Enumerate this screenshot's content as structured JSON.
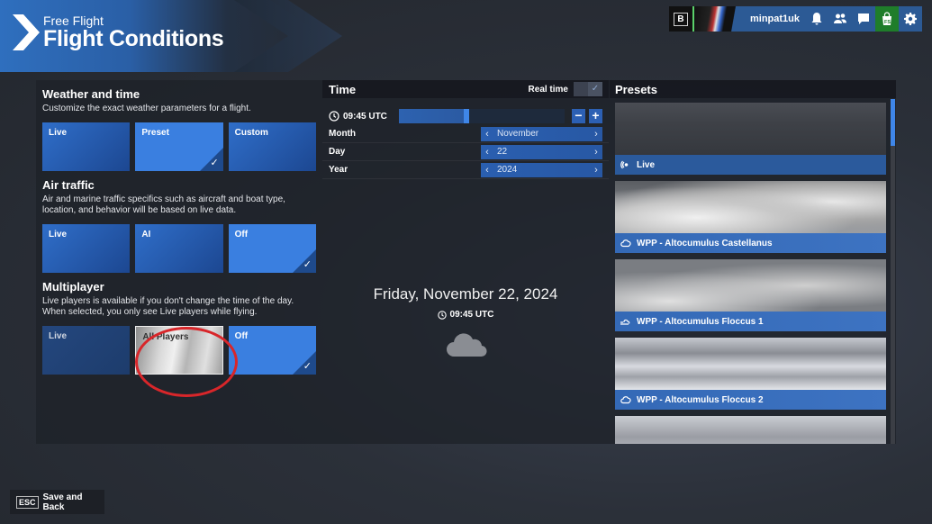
{
  "header": {
    "subtitle": "Free Flight",
    "title": "Flight Conditions"
  },
  "userbar": {
    "badge": "B",
    "username": "minpat1uk",
    "icons": [
      "bell-icon",
      "friends-icon",
      "chat-icon",
      "store-icon",
      "gear-icon"
    ],
    "store_label": "FS"
  },
  "weather": {
    "title": "Weather and time",
    "description": "Customize the exact weather parameters for a flight.",
    "options": [
      {
        "label": "Live",
        "selected": false
      },
      {
        "label": "Preset",
        "selected": true
      },
      {
        "label": "Custom",
        "selected": false
      }
    ]
  },
  "air_traffic": {
    "title": "Air traffic",
    "description": "Air and marine traffic specifics such as aircraft and boat type, location, and behavior will be based on live data.",
    "options": [
      {
        "label": "Live",
        "selected": false
      },
      {
        "label": "AI",
        "selected": false
      },
      {
        "label": "Off",
        "selected": true
      }
    ]
  },
  "multiplayer": {
    "title": "Multiplayer",
    "description": "Live players is available if you don't change the time of the day. When selected, you only see Live players while flying.",
    "options": [
      {
        "label": "Live",
        "selected": false,
        "disabled": true
      },
      {
        "label": "All Players",
        "selected": false,
        "highlighted": true
      },
      {
        "label": "Off",
        "selected": true
      }
    ]
  },
  "time": {
    "title": "Time",
    "real_time_label": "Real time",
    "real_time_checked": false,
    "clock_label": "09:45 UTC",
    "slider_fraction": 0.406,
    "minus": "−",
    "plus": "+",
    "fields": [
      {
        "label": "Month",
        "value": "November"
      },
      {
        "label": "Day",
        "value": "22"
      },
      {
        "label": "Year",
        "value": "2024"
      }
    ],
    "full_date": "Friday, November 22, 2024",
    "full_time": "09:45 UTC",
    "weather_icon": "cloud-icon"
  },
  "presets": {
    "title": "Presets",
    "items": [
      {
        "label": "Live",
        "icon": "live-signal-icon"
      },
      {
        "label": "WPP - Altocumulus Castellanus",
        "icon": "cloud-icon"
      },
      {
        "label": "WPP - Altocumulus Floccus 1",
        "icon": "cloud-wind-icon"
      },
      {
        "label": "WPP - Altocumulus Floccus 2",
        "icon": "cloud-icon"
      },
      {
        "label": "",
        "icon": ""
      }
    ]
  },
  "footer": {
    "key": "ESC",
    "save_back_label": "Save and Back"
  },
  "colors": {
    "accent": "#3a7fe0",
    "tile": "#2f6ec9",
    "annotation": "#d8262a",
    "store": "#1f7d2a"
  }
}
